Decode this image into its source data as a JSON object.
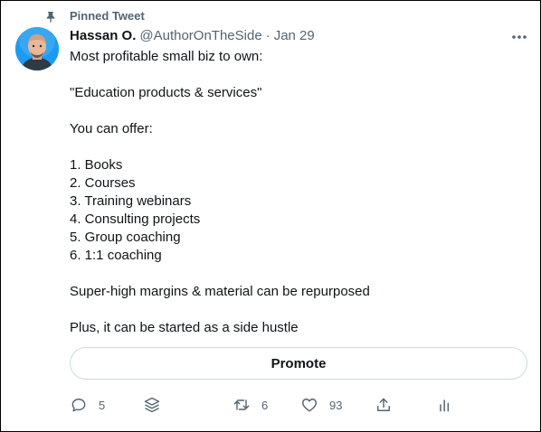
{
  "tweet": {
    "pinned_label": "Pinned Tweet",
    "author_name": "Hassan O.",
    "author_handle": "@AuthorOnTheSide",
    "separator": "·",
    "date": "Jan 29",
    "lines": [
      "Most profitable small biz to own:",
      "",
      "\"Education products & services\"",
      "",
      "You can offer:",
      "",
      "1. Books",
      "2. Courses",
      "3. Training webinars",
      "4. Consulting projects",
      "5. Group coaching",
      "6. 1:1 coaching",
      "",
      "Super-high margins & material can be repurposed",
      "",
      "Plus, it can be started as a side hustle"
    ],
    "promote_label": "Promote",
    "reply_count": "5",
    "retweet_count": "6",
    "like_count": "93"
  },
  "colors": {
    "text": "#0f1419",
    "secondary": "#536471",
    "border": "#cfd9de",
    "avatar_bg": "#1d9bf0"
  },
  "icons": [
    "pin-icon",
    "more-icon",
    "reply-icon",
    "layers-icon",
    "retweet-icon",
    "like-icon",
    "share-icon",
    "analytics-icon"
  ]
}
